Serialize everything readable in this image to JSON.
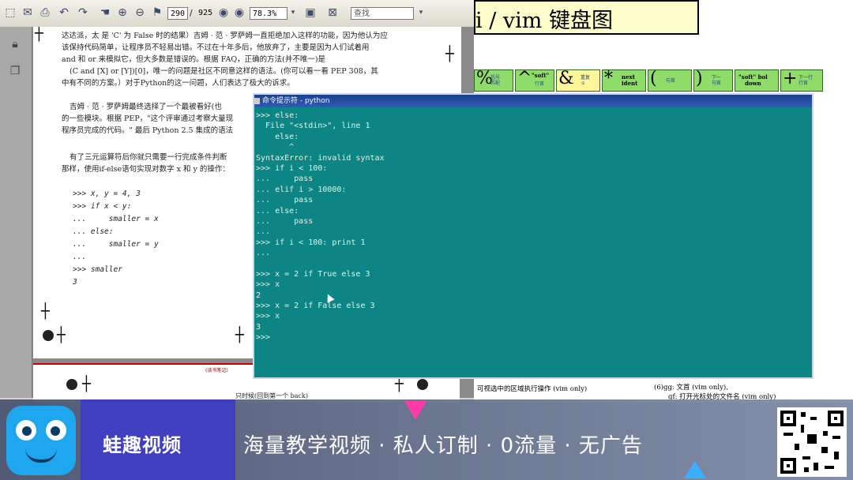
{
  "pdf_reader": {
    "current_page": "290",
    "page_separator": "/",
    "total_pages": "925",
    "zoom": "78.3%",
    "search_placeholder": "查找",
    "page1_lines": [
      "达达派，太 是 'C' 为 False 时的结果）吉姆 · 范 · 罗萨姆一直拒绝加入这样的功能，因为他认为应",
      "该保持代码简单，让程序员不轻易出错。不过在十年多后，他放弃了，主要是因为人们试着用",
      "and 和 or 来模拟它，但大多数是错误的。根据 FAQ，正确的方法(并不唯一)是",
      "(C and [X] or [Y])[0]，唯一的问题是社区不同意这样的语法。(你可以看一看 PEP 308，其",
      "中有不同的方案。）对于Python的这一问题，人们表达了极大的诉求。",
      "吉姆 · 范 · 罗萨姆最终选择了一个最被看好(也",
      "的一些模块。根据 PEP，\"这个评审通过考察大量现",
      "程序员完成的代码。\" 最后 Python 2.5 集成的语法",
      "有了三元运算符后你就只需要一行完成条件判断",
      "那样，使用if-else语句实现对数字 x 和 y 的操作："
    ],
    "page1_code": [
      ">>> x, y = 4, 3",
      ">>> if x < y:",
      "...     smaller = x",
      "... else:",
      "...     smaller = y",
      "...",
      ">>> smaller",
      "3"
    ],
    "page2_footer": "(读书笔记)",
    "page2_line": "只时候(回到第一个 back)"
  },
  "vim_sheet": {
    "title": "i / vim 键盘图",
    "keys": [
      {
        "big": "%",
        "small": "括号\n匹配",
        "bold": ""
      },
      {
        "big": "^",
        "small": "行首",
        "bold": "\"soft\""
      },
      {
        "big": "&",
        "small": "重复\n:s",
        "bold": ""
      },
      {
        "big": "*",
        "small": "",
        "bold": "next\nident"
      },
      {
        "big": "(",
        "small": "句首",
        "bold": ""
      },
      {
        "big": ")",
        "small": "下一\n句首",
        "bold": ""
      },
      {
        "big": "",
        "small": "",
        "bold": "\"soft\" bol\ndown"
      },
      {
        "big": "+",
        "small": "下一行\n行首",
        "bold": ""
      }
    ],
    "bottom_lines": [
      "可视选中的区域执行操作 (vim only)",
      "(6)gg: 文首 (vim only),",
      "gf: 打开光标处的文件名 (vim only)"
    ]
  },
  "cmd": {
    "title": "命令提示符 - python",
    "lines": [
      ">>> else:",
      "  File \"<stdin>\", line 1",
      "    else:",
      "       ^",
      "SyntaxError: invalid syntax",
      ">>> if i < 100:",
      "...     pass",
      "... elif i > 10000:",
      "...     pass",
      "... else:",
      "...     pass",
      "...",
      ">>> if i < 100: print 1",
      "...",
      "",
      ">>> x = 2 if True else 3",
      ">>> x",
      "2",
      ">>> x = 2 if False else 3",
      ">>> x",
      "3",
      ">>>"
    ]
  },
  "banner": {
    "brand": "蛙趣视频",
    "slogan": "海量教学视频 · 私人订制 · 0流量 · 无广告"
  }
}
